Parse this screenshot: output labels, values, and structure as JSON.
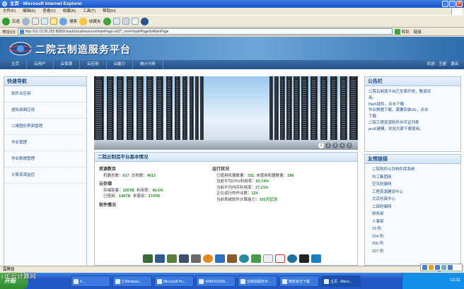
{
  "window": {
    "title": "主页 - Microsoft Internet Explorer",
    "menu": [
      "文件(F)",
      "编辑(E)",
      "查看(V)",
      "收藏(A)",
      "工具(T)",
      "帮助(H)"
    ],
    "toolbar": {
      "back": "后退",
      "search": "搜索",
      "favorites": "收藏夹"
    },
    "address_label": "地址(D)",
    "address_value": "http://10.12.95.253:8080/cloud/cloudresource/mainPage.ed2?_msr=/mainPage/toMainPage",
    "go_label": "转到",
    "links_label": "链接"
  },
  "site": {
    "title": "二院云制造服务平台",
    "nav": [
      "主页",
      "云用户",
      "云资源",
      "云应用",
      "云能力",
      "统计分析"
    ],
    "nav_right": [
      "欢迎：王超",
      "退出"
    ]
  },
  "left_sidebar": {
    "title": "快速导航",
    "items": [
      "软件业应用",
      "虚拟桌面应用",
      "二维图形界面管理",
      "作业管理",
      "作业数据管理",
      "计算资源监控"
    ]
  },
  "banner": {
    "pages": [
      "1",
      "2",
      "3",
      "4",
      "5"
    ],
    "active_page": "1"
  },
  "platform": {
    "title": "二院云制造平台基本情况",
    "resources": {
      "heading": "资源数目",
      "rows": [
        {
          "label": "机器总数：",
          "value": "617",
          "label2": "总核数：",
          "value2": "4612"
        }
      ]
    },
    "storage": {
      "heading": "云存储",
      "rows": [
        {
          "label": "存储容量：",
          "value": "320TB",
          "label2": "利用率：",
          "value2": "45.6%"
        },
        {
          "label": "已使用：",
          "value": "146TB",
          "label2": "未使用：",
          "value2": "174TB"
        }
      ]
    },
    "software": {
      "heading": "软件情况"
    },
    "running": {
      "heading": "运行状况",
      "rows": [
        {
          "label": "已使用机器数量：",
          "value": "331",
          "label2": "未使用机器数量：",
          "value2": "286"
        },
        {
          "label": "当前平均CPU利用率：",
          "value": "63.74%"
        },
        {
          "label": "当前平均内存利用率：",
          "value": "27.21%"
        },
        {
          "label": "正在运行的作业数：",
          "value": "124"
        },
        {
          "label": "当前系统软件计算能力：",
          "value": "103万亿次"
        }
      ]
    }
  },
  "notice": {
    "title": "公告栏",
    "lines": [
      "二院云制造平台已全面开放，敬请试",
      "用。",
      "flash插件，点击下载",
      "作业数据下载，需要安装XE，点击",
      "下载",
      "二院工程资源软件许可证列表",
      "proE建模，欢迎大家下载使用。"
    ]
  },
  "links": {
    "title": "友情链接",
    "items": [
      "二院软件公共构件库系统",
      "科工集团网",
      "空天防御网",
      "工程资源建设中心",
      "北京仿真中心",
      "二部防御网",
      "财务部",
      "人事部",
      "23 所",
      "204 所",
      "206 所",
      "207 所"
    ]
  },
  "statusbar": {
    "left": "完毕",
    "zone": "Internet"
  },
  "taskbar": {
    "start": "开始",
    "tasks": [
      "4 ...",
      "2 Windows...",
      "Microsoft Po...",
      "4040313109...",
      "云制造服务平...",
      "微软官方下载",
      "主页 - Micro..."
    ],
    "active_task": 6,
    "clock": "13:31"
  },
  "watermark": "i.IE云计算网",
  "desktop_label": "云计算"
}
